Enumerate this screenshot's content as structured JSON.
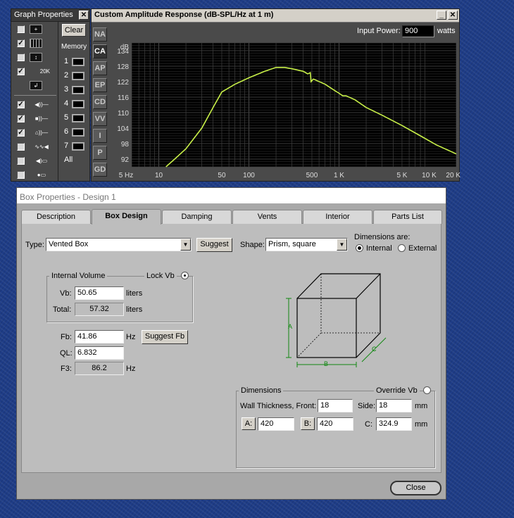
{
  "graph_props": {
    "title": "Graph Properties",
    "close": "✕",
    "clear_label": "Clear",
    "memory_label": "Memory",
    "memory_slots": [
      "1",
      "2",
      "3",
      "4",
      "5",
      "6",
      "7"
    ],
    "all_label": "All",
    "row_icons": [
      "crosshair-icon",
      "grid-icon",
      "scale-arrows-icon",
      "range-20k-icon",
      "export-icon"
    ],
    "range_label": "20K",
    "check": "✓"
  },
  "graph": {
    "title": "Custom Amplitude Response (dB-SPL/Hz at 1 m)",
    "minimize": "_",
    "close": "✕",
    "side_buttons": [
      "NA",
      "CA",
      "AP",
      "EP",
      "CD",
      "VV",
      "I",
      "P",
      "GD"
    ],
    "active_side": "CA",
    "input_power_label": "Input Power:",
    "input_power_value": "900",
    "input_power_unit": "watts",
    "y_unit": "dB",
    "y_ticks": [
      "134",
      "128",
      "122",
      "116",
      "110",
      "104",
      "98",
      "92"
    ],
    "x_ticks": [
      "5 Hz",
      "10",
      "50",
      "100",
      "500",
      "1 K",
      "5 K",
      "10 K",
      "20 K"
    ]
  },
  "chart_data": {
    "type": "line",
    "title": "Custom Amplitude Response (dB-SPL/Hz at 1 m)",
    "xscale": "log",
    "xlim": [
      5,
      20000
    ],
    "ylim": [
      89,
      137
    ],
    "grid": true,
    "series": [
      {
        "color": "#c8f048",
        "points": [
          [
            12,
            89
          ],
          [
            15,
            92
          ],
          [
            20,
            96
          ],
          [
            30,
            104
          ],
          [
            40,
            112
          ],
          [
            50,
            118
          ],
          [
            70,
            121
          ],
          [
            100,
            123.5
          ],
          [
            150,
            126
          ],
          [
            200,
            127.5
          ],
          [
            250,
            127.5
          ],
          [
            300,
            127
          ],
          [
            400,
            126
          ],
          [
            450,
            125
          ],
          [
            480,
            125.5
          ],
          [
            490,
            122
          ],
          [
            520,
            123
          ],
          [
            700,
            121
          ],
          [
            900,
            118.5
          ],
          [
            1000,
            117.5
          ],
          [
            1100,
            116.5
          ],
          [
            1200,
            116.5
          ],
          [
            1500,
            115
          ],
          [
            2000,
            112
          ],
          [
            3000,
            109
          ],
          [
            5000,
            105
          ],
          [
            8000,
            101
          ],
          [
            12000,
            97.5
          ],
          [
            20000,
            94
          ]
        ]
      }
    ]
  },
  "box": {
    "title": "Box Properties - Design 1",
    "tabs": [
      "Description",
      "Box Design",
      "Damping",
      "Vents",
      "Interior",
      "Parts List"
    ],
    "active_tab": "Box Design",
    "type_label": "Type:",
    "type_value": "Vented Box",
    "suggest_label": "Suggest",
    "shape_label": "Shape:",
    "shape_value": "Prism, square",
    "dims_are_label": "Dimensions are:",
    "internal_label": "Internal",
    "external_label": "External",
    "internal_volume_label": "Internal Volume",
    "lock_vb_label": "Lock Vb",
    "vb_label": "Vb:",
    "vb_value": "50.65",
    "vb_unit": "liters",
    "total_label": "Total:",
    "total_value": "57.32",
    "total_unit": "liters",
    "fb_label": "Fb:",
    "fb_value": "41.86",
    "fb_unit": "Hz",
    "suggest_fb_label": "Suggest Fb",
    "ql_label": "QL:",
    "ql_value": "6.832",
    "f3_label": "F3:",
    "f3_value": "86.2",
    "f3_unit": "Hz",
    "dim_a": "A",
    "dim_b": "B",
    "dim_c": "C",
    "dimensions_label": "Dimensions",
    "override_vb_label": "Override Vb",
    "wall_label": "Wall Thickness, Front:",
    "wall_front": "18",
    "side_label": "Side:",
    "wall_side": "18",
    "mm": "mm",
    "a_label": "A:",
    "a_value": "420",
    "b_label": "B:",
    "b_value": "420",
    "c_label": "C:",
    "c_value": "324.9",
    "close_label": "Close"
  }
}
